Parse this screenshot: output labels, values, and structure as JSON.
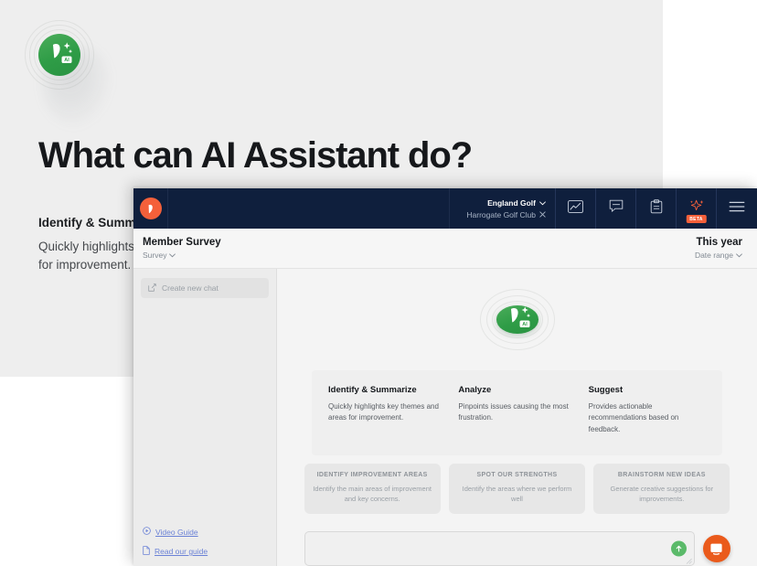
{
  "background_page": {
    "heading": "What can AI Assistant do?",
    "section_title": "Identify & Summarize",
    "section_body": "Quickly highlights key themes and areas for improvement.",
    "logo_badge_text": "AI"
  },
  "app": {
    "topnav": {
      "logo_icon": "pitchero-logo-icon",
      "org": {
        "name": "England Golf",
        "club": "Harrogate Golf Club",
        "club_remove_icon": "close-icon",
        "chevron_icon": "chevron-down-icon"
      },
      "icons": [
        {
          "name": "analytics-icon",
          "label": "Analytics"
        },
        {
          "name": "messages-icon",
          "label": "Messages"
        },
        {
          "name": "clipboard-icon",
          "label": "Tasks"
        },
        {
          "name": "ai-sparkle-icon",
          "label": "AI Assistant",
          "badge": "BETA"
        },
        {
          "name": "hamburger-menu-icon",
          "label": "Menu"
        }
      ]
    },
    "subheader": {
      "title": "Member Survey",
      "breadcrumb": "Survey",
      "date_value": "This year",
      "date_label": "Date range",
      "chevron_icon": "chevron-down-icon"
    },
    "sidebar": {
      "new_chat_label": "Create new chat",
      "new_chat_icon": "compose-icon",
      "links": [
        {
          "label": "Video Guide",
          "icon": "play-circle-icon"
        },
        {
          "label": "Read our guide",
          "icon": "document-icon"
        }
      ]
    },
    "main": {
      "hero_logo_badge": "AI",
      "cards": [
        {
          "title": "Identify & Summarize",
          "body": "Quickly highlights key themes and areas for improvement."
        },
        {
          "title": "Analyze",
          "body": "Pinpoints issues causing the most frustration."
        },
        {
          "title": "Suggest",
          "body": "Provides actionable recommendations based on feedback."
        }
      ],
      "chips": [
        {
          "title": "IDENTIFY IMPROVEMENT AREAS",
          "body": "Identify the main areas of improvement and key concerns."
        },
        {
          "title": "SPOT OUR STRENGTHS",
          "body": "Identify the areas where we perform well"
        },
        {
          "title": "BRAINSTORM NEW IDEAS",
          "body": "Generate creative suggestions for improvements."
        }
      ],
      "composer": {
        "value": "",
        "placeholder": "",
        "send_icon": "arrow-up-icon"
      },
      "intercom_icon": "intercom-chat-icon"
    }
  },
  "colors": {
    "nav_bg": "#0f1f3d",
    "brand_orange": "#f4603a",
    "ai_green": "#2e9c46",
    "send_green": "#5bba6a",
    "intercom_orange": "#ea5a1b",
    "link_blue": "#6b82d6"
  }
}
